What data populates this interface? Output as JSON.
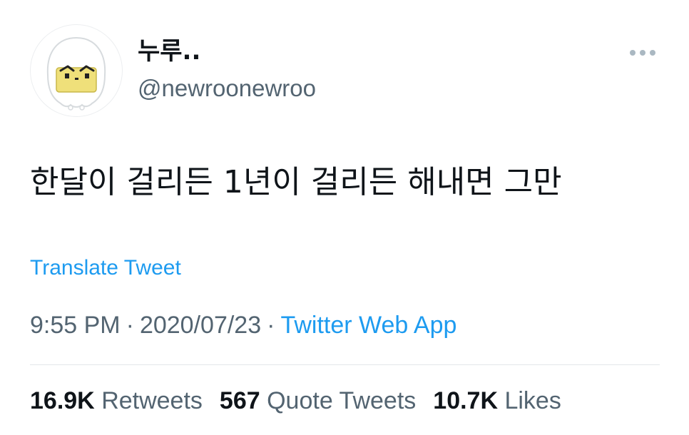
{
  "author": {
    "display_name": "누루..",
    "handle": "@newroonewroo",
    "avatar_icon": "ghost-character-avatar"
  },
  "more_icon": "more-horizontal-icon",
  "tweet": {
    "text": "한달이 걸리든 1년이 걸리든 해내면 그만",
    "translate_label": "Translate Tweet"
  },
  "meta": {
    "time": "9:55 PM",
    "separator": "·",
    "date": "2020/07/23",
    "source": "Twitter Web App"
  },
  "stats": {
    "retweets": {
      "count": "16.9K",
      "label": "Retweets"
    },
    "quotes": {
      "count": "567",
      "label": "Quote Tweets"
    },
    "likes": {
      "count": "10.7K",
      "label": "Likes"
    }
  },
  "colors": {
    "link": "#1d9bf0",
    "secondary_text": "#536471",
    "primary_text": "#0f1419"
  }
}
